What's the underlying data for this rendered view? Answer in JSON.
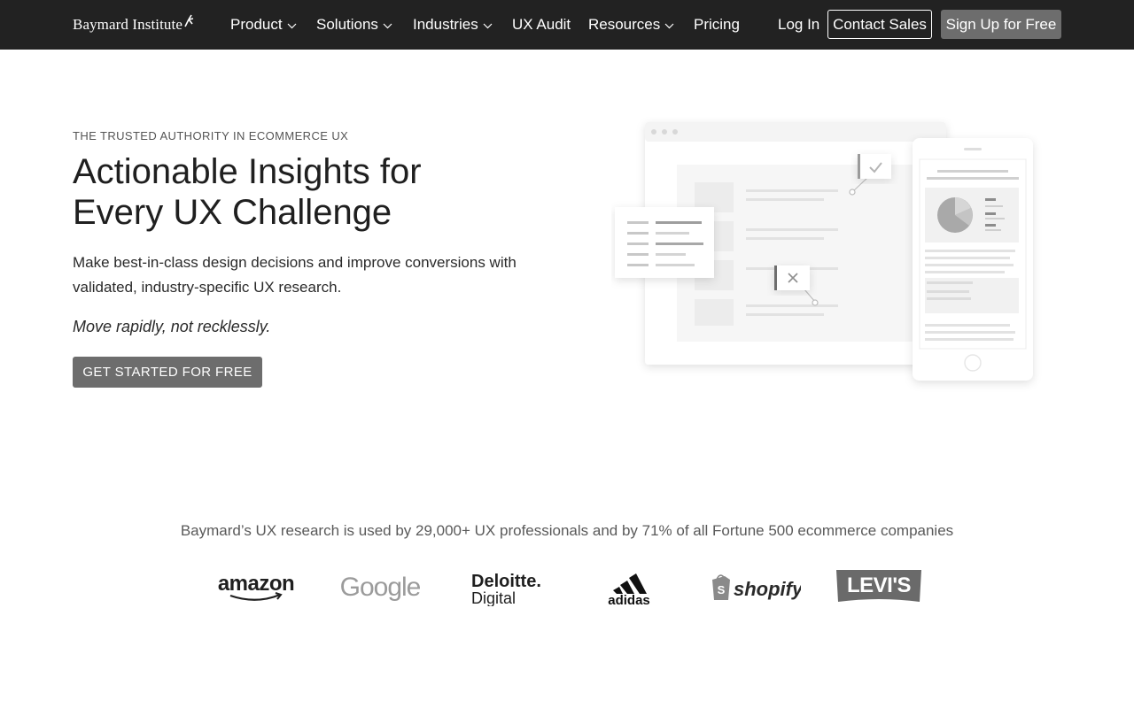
{
  "nav": {
    "logo": "Baymard Institute",
    "items": [
      {
        "label": "Product",
        "dropdown": true
      },
      {
        "label": "Solutions",
        "dropdown": true
      },
      {
        "label": "Industries",
        "dropdown": true
      },
      {
        "label": "UX Audit",
        "dropdown": false
      },
      {
        "label": "Resources",
        "dropdown": true
      },
      {
        "label": "Pricing",
        "dropdown": false
      }
    ],
    "login": "Log In",
    "contact": "Contact Sales",
    "signup": "Sign Up for Free"
  },
  "hero": {
    "eyebrow": "THE TRUSTED AUTHORITY IN ECOMMERCE UX",
    "headline_line1": "Actionable Insights for",
    "headline_line2": "Every UX Challenge",
    "subhead": "Make best-in-class design decisions and improve conversions with validated, industry-specific UX research.",
    "tagline": "Move rapidly, not recklessly.",
    "cta": "GET STARTED FOR FREE"
  },
  "trust": {
    "text": "Baymard’s UX research is used by 29,000+ UX professionals and by 71% of all Fortune 500 ecommerce companies",
    "logos": [
      "amazon",
      "Google",
      "Deloitte.",
      "Digital",
      "adidas",
      "shopify",
      "LEVI'S"
    ]
  },
  "colors": {
    "nav_bg": "#222222",
    "button_gray": "#6d6d6d",
    "text_dark": "#1f1f1f",
    "text_muted": "#5a5a5a"
  }
}
